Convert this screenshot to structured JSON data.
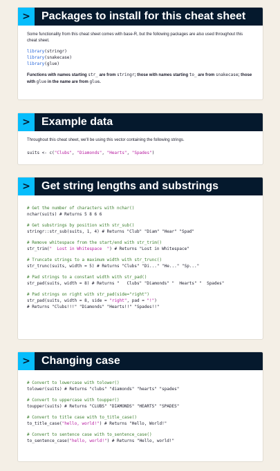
{
  "packages": {
    "title": "Packages to install for this cheat sheet",
    "intro": "Some functionality from this cheat sheet comes with base-R, but the following packages are also used throughout this cheat sheet.",
    "lines": [
      {
        "kw": "library",
        "arg": "(stringr)"
      },
      {
        "kw": "library",
        "arg": "(snakecase)"
      },
      {
        "kw": "library",
        "arg": "(glue)"
      }
    ],
    "note": {
      "p1": "Functions with names starting ",
      "c1": "str_",
      "p2": " are from ",
      "c2": "stringr",
      "p3": "; those with names starting ",
      "c3": "to_",
      "p4": " are from ",
      "c4": "snakecase",
      "p5": "; those with ",
      "c5": "glue",
      "p6": " in the name are from ",
      "c6": "glue",
      "p7": "."
    }
  },
  "example": {
    "title": "Example data",
    "intro": "Throughout this cheat sheet, we'll be using this vector containing the following strings.",
    "code_prefix": "suits <- c(",
    "strings": [
      "\"Clubs\"",
      "\"Diamonds\"",
      "\"Hearts\"",
      "\"Spades\""
    ],
    "sep": ", ",
    "code_suffix": ")"
  },
  "lengths": {
    "title": "Get string lengths and substrings",
    "c1": "# Get the number of characters with nchar()",
    "l1": "nchar(suits) # Returns 5 8 6 6",
    "c2": "# Get substrings by position with str_sub()",
    "l2": "stringr::str_sub(suits, 1, 4) # Returns \"Club\" \"Diam\" \"Hear\" \"Spad\"",
    "c3": "# Remove whitespace from the start/end with str_trim()",
    "l3a": "str_trim(",
    "l3s": "\"  Lost in Whitespace  \"",
    "l3b": ") # Returns \"Lost in Whitespace\"",
    "c4": "# Truncate strings to a maximum width with str_trunc()",
    "l4": "str_trunc(suits, width = 5) # Returns \"Clubs\" \"Di...\" \"He...\" \"Sp...\"",
    "c5": "# Pad strings to a constant width with str_pad()",
    "l5": "str_pad(suits, width = 8) # Returns \"   Clubs\" \"Diamonds\" \"  Hearts\" \"  Spades\"",
    "c6": "# Pad strings on right with str_pad(side=\"right\")",
    "l6a": "str_pad(suits, width = 8, side = ",
    "l6s1": "\"right\"",
    "l6b": ", pad = ",
    "l6s2": "\"!\"",
    "l6c": ")",
    "l7": "# Returns \"Clubs!!!\" \"Diamonds\" \"Hearts!!\" \"Spades!!\""
  },
  "case": {
    "title": "Changing case",
    "c1": "# Convert to lowercase with tolower()",
    "l1": "tolower(suits) # Returns \"clubs\" \"diamonds\" \"hearts\" \"spades\"",
    "c2": "# Convert to uppercase with toupper()",
    "l2": "toupper(suits) # Returns \"CLUBS\" \"DIAMONDS\" \"HEARTS\" \"SPADES\"",
    "c3": "# Convert to title case with to_title_case()",
    "l3a": "to_title_case(",
    "l3s": "\"hello, world!\"",
    "l3b": ") # Returns \"Hello, World!\"",
    "c4": "# Convert to sentence case with to_sentence_case()",
    "l4a": "to_sentence_case(",
    "l4s": "\"hello, world!\"",
    "l4b": ") # Returns \"Hello, world!\""
  },
  "icons": {
    "chevron": ">"
  },
  "colors": {
    "navy": "#05192d",
    "green": "#03ef62",
    "blue": "#06bdfc",
    "comment": "#3a7d2c",
    "string": "#b5179e",
    "keyword": "#1e5fd8"
  }
}
